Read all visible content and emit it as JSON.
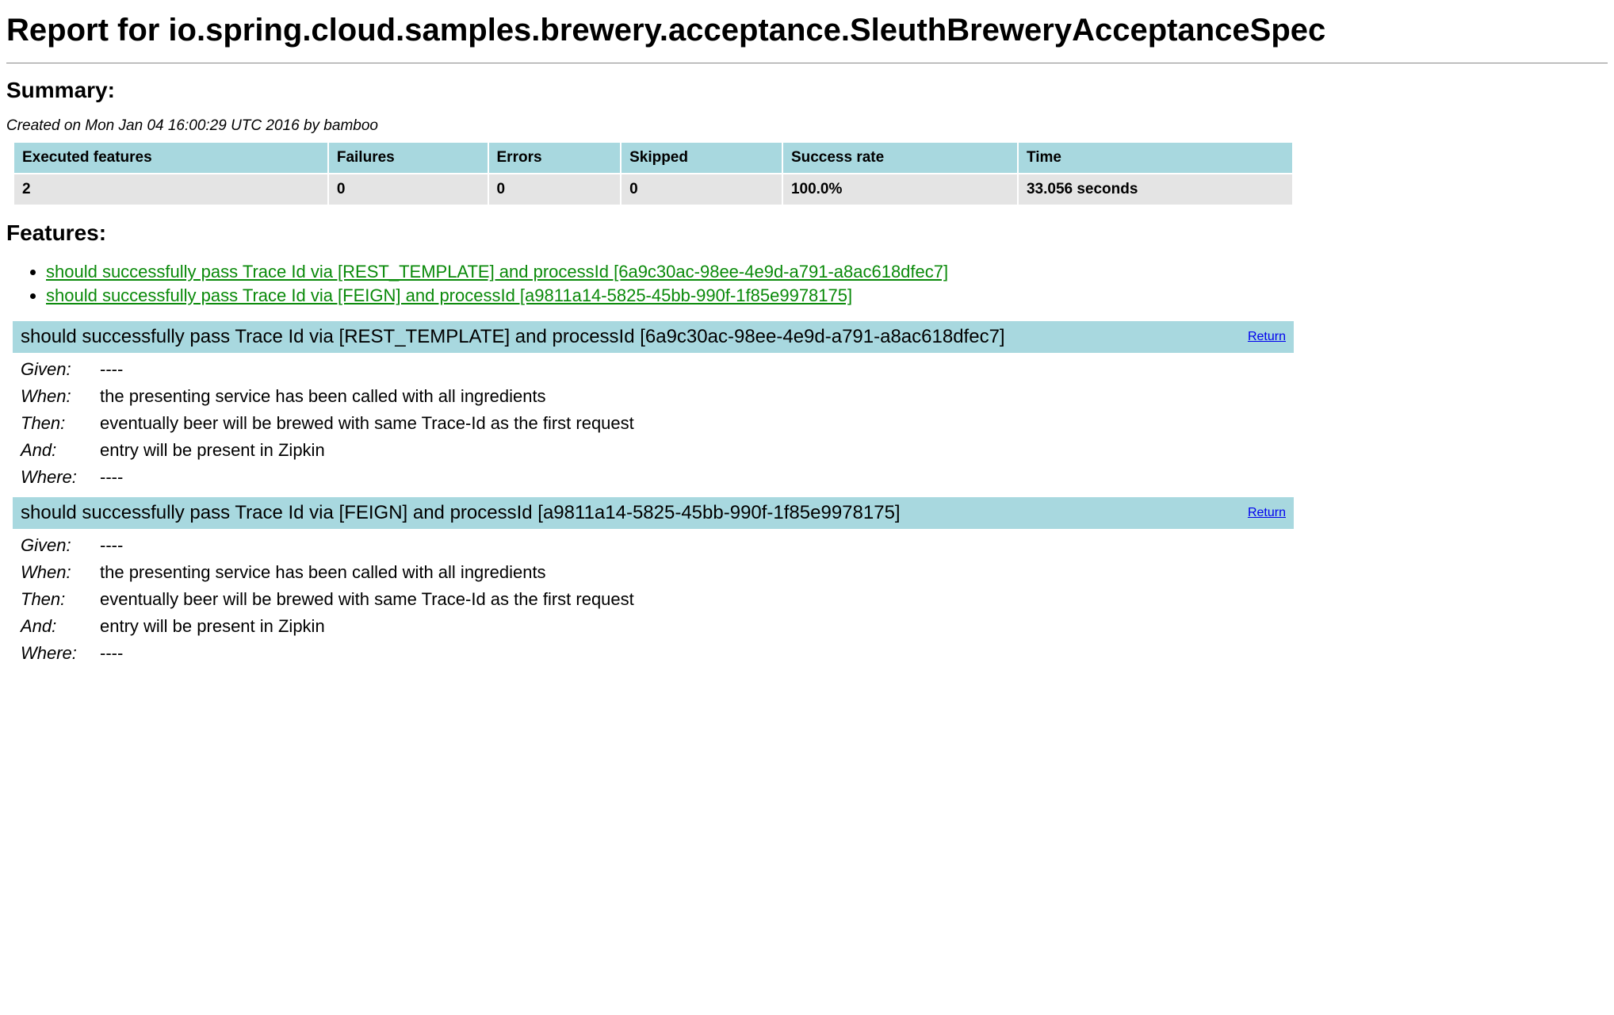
{
  "title": "Report for io.spring.cloud.samples.brewery.acceptance.SleuthBreweryAcceptanceSpec",
  "summary_heading": "Summary:",
  "created": "Created on Mon Jan 04 16:00:29 UTC 2016 by bamboo",
  "summary": {
    "headers": [
      "Executed features",
      "Failures",
      "Errors",
      "Skipped",
      "Success rate",
      "Time"
    ],
    "values": [
      "2",
      "0",
      "0",
      "0",
      "100.0%",
      "33.056 seconds"
    ]
  },
  "features_heading": "Features:",
  "feature_links": [
    "should successfully pass Trace Id via [REST_TEMPLATE] and processId [6a9c30ac-98ee-4e9d-a791-a8ac618dfec7]",
    "should successfully pass Trace Id via [FEIGN] and processId [a9811a14-5825-45bb-990f-1f85e9978175]"
  ],
  "return_label": "Return",
  "features": [
    {
      "title": "should successfully pass Trace Id via [REST_TEMPLATE] and processId [6a9c30ac-98ee-4e9d-a791-a8ac618dfec7]",
      "steps": [
        {
          "label": "Given:",
          "text": "----"
        },
        {
          "label": "When:",
          "text": "the presenting service has been called with all ingredients"
        },
        {
          "label": "Then:",
          "text": "eventually beer will be brewed with same Trace-Id as the first request"
        },
        {
          "label": "And:",
          "text": "entry will be present in Zipkin"
        },
        {
          "label": "Where:",
          "text": "----"
        }
      ]
    },
    {
      "title": "should successfully pass Trace Id via [FEIGN] and processId [a9811a14-5825-45bb-990f-1f85e9978175]",
      "steps": [
        {
          "label": "Given:",
          "text": "----"
        },
        {
          "label": "When:",
          "text": "the presenting service has been called with all ingredients"
        },
        {
          "label": "Then:",
          "text": "eventually beer will be brewed with same Trace-Id as the first request"
        },
        {
          "label": "And:",
          "text": "entry will be present in Zipkin"
        },
        {
          "label": "Where:",
          "text": "----"
        }
      ]
    }
  ]
}
